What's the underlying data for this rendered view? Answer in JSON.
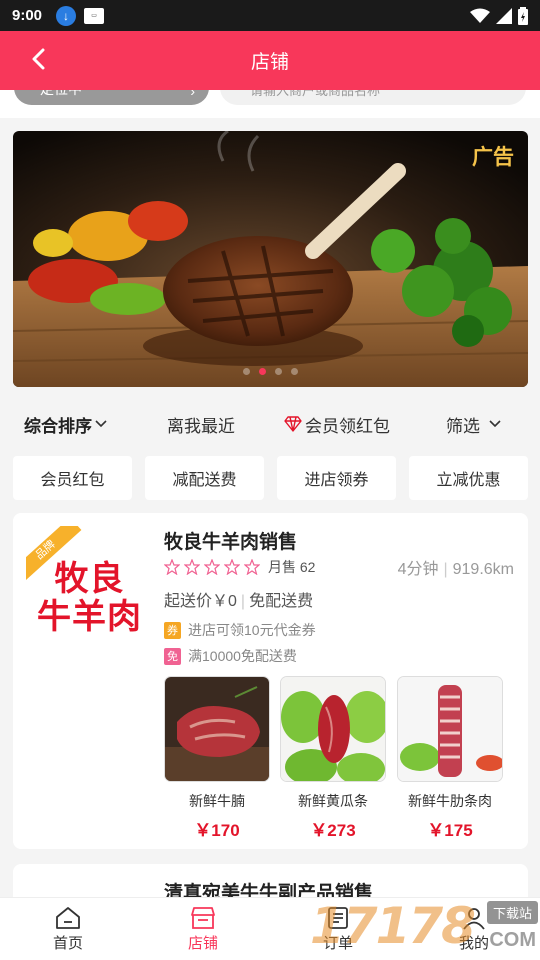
{
  "status_bar": {
    "time": "9:00"
  },
  "header": {
    "title": "店铺"
  },
  "search": {
    "location_text": "定位中",
    "placeholder": "请输入商户或商品名称"
  },
  "banner": {
    "ad_label": "广告",
    "slide_count": 4,
    "active_slide": 2
  },
  "sort_bar": {
    "comprehensive": "综合排序",
    "nearest": "离我最近",
    "member_redpacket": "会员领红包",
    "filter": "筛选"
  },
  "filter_chips": [
    "会员红包",
    "减配送费",
    "进店领券",
    "立减优惠"
  ],
  "shops": [
    {
      "brand_badge": "品牌",
      "logo_line1": "牧良",
      "logo_line2": "牛羊肉",
      "name": "牧良牛羊肉销售",
      "rating_stars": 0,
      "monthly_sales": "月售 62",
      "delivery_time": "4分钟",
      "distance": "919.6km",
      "min_order": "起送价￥0",
      "delivery_fee": "免配送费",
      "promotions": [
        {
          "tag": "券",
          "text": "进店可领10元代金券",
          "color": "#f5a623"
        },
        {
          "tag": "免",
          "text": "满10000免配送费",
          "color": "#f06292"
        }
      ],
      "products": [
        {
          "name": "新鲜牛腩",
          "price": "￥170"
        },
        {
          "name": "新鲜黄瓜条",
          "price": "￥273"
        },
        {
          "name": "新鲜牛肋条肉",
          "price": "￥175"
        }
      ]
    },
    {
      "name": "清真宛美牛牛副产品销售"
    }
  ],
  "tab_bar": {
    "tabs": [
      {
        "label": "首页",
        "icon": "home-icon"
      },
      {
        "label": "店铺",
        "icon": "store-icon"
      },
      {
        "label": "订单",
        "icon": "order-icon"
      },
      {
        "label": "我的",
        "icon": "profile-icon"
      }
    ],
    "active": 1
  },
  "watermark": {
    "digits": "17178",
    "tag": "下载站",
    "suffix": ".COM"
  },
  "colors": {
    "brand": "#f8375a",
    "price": "#e3142a",
    "ad_gold": "#f5c34a",
    "brand_badge": "#f7b12b"
  }
}
